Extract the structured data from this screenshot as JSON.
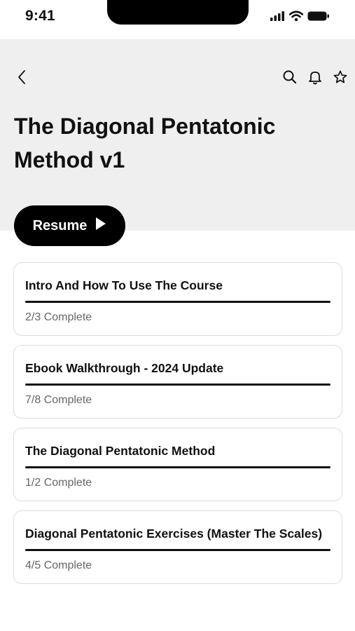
{
  "status_bar": {
    "time": "9:41"
  },
  "header": {
    "title": "The Diagonal Pentatonic Method v1"
  },
  "resume_button": {
    "label": "Resume"
  },
  "modules": [
    {
      "title": "Intro And How To Use The Course",
      "status": "2/3 Complete",
      "progress": 1.0
    },
    {
      "title": "Ebook Walkthrough - 2024 Update",
      "status": "7/8 Complete",
      "progress": 1.0
    },
    {
      "title": "The Diagonal Pentatonic Method",
      "status": "1/2 Complete",
      "progress": 1.0
    },
    {
      "title": "Diagonal Pentatonic Exercises (Master The Scales)",
      "status": "4/5 Complete",
      "progress": 1.0
    }
  ]
}
